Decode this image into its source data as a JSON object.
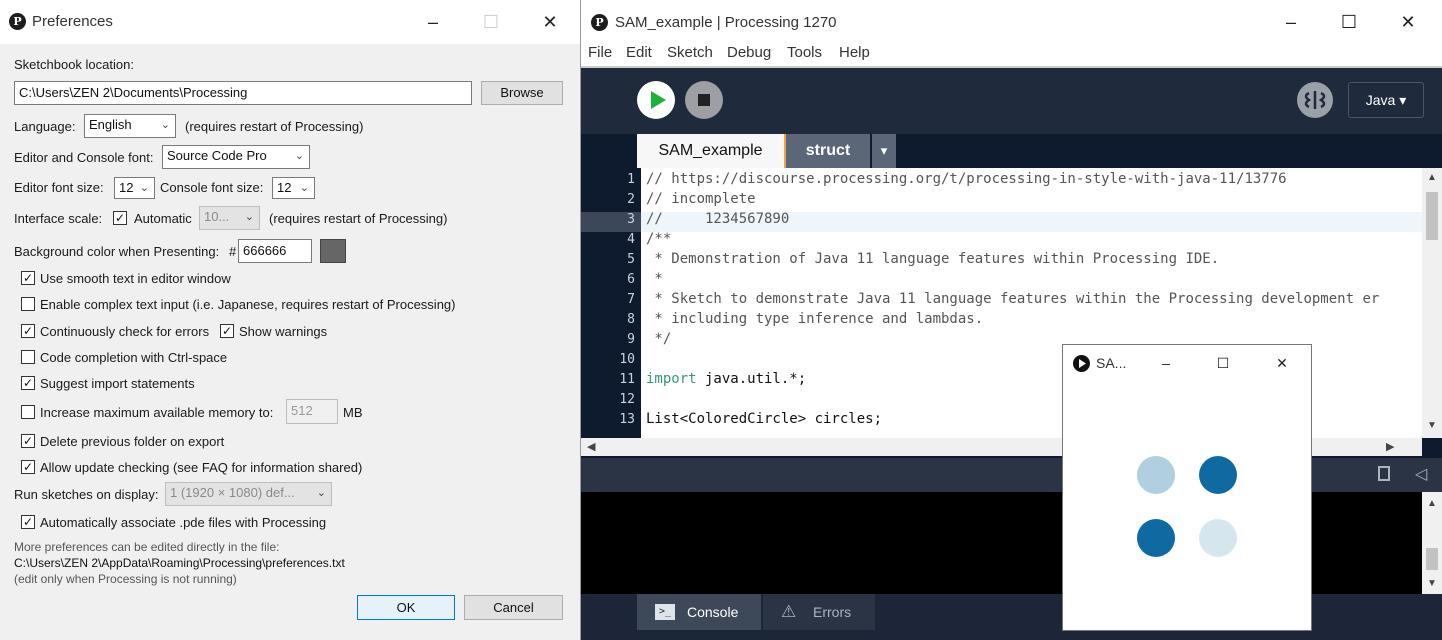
{
  "prefs": {
    "title": "Preferences",
    "sketchbook_label": "Sketchbook location:",
    "sketchbook_path": "C:\\Users\\ZEN 2\\Documents\\Processing",
    "browse": "Browse",
    "language_label": "Language:",
    "language_value": "English",
    "language_note": "(requires restart of Processing)",
    "font_label": "Editor and Console font:",
    "font_value": "Source Code Pro",
    "editor_size_label": "Editor font size:",
    "editor_size_value": "12",
    "console_size_label": "Console font size:",
    "console_size_value": "12",
    "scale_label": "Interface scale:",
    "scale_auto_label": "Automatic",
    "scale_value": "10...",
    "scale_note": "(requires restart of Processing)",
    "bg_label": "Background color when Presenting:",
    "bg_hash": "#",
    "bg_value": "666666",
    "bg_color": "#666666",
    "options": {
      "smooth": "Use smooth text in editor window",
      "complex": "Enable complex text input (i.e. Japanese, requires restart of Processing)",
      "check_errors": "Continuously check for errors",
      "warnings": "Show warnings",
      "completion": "Code completion with Ctrl-space",
      "imports": "Suggest import statements",
      "memory": "Increase maximum available memory to:",
      "memory_value": "512",
      "memory_unit": "MB",
      "delete_prev": "Delete previous folder on export",
      "update_check": "Allow update checking (see FAQ for information shared)",
      "associate": "Automatically associate .pde files with Processing"
    },
    "display_label": "Run sketches on display:",
    "display_value": "1 (1920 × 1080) def...",
    "more_note": "More preferences can be edited directly in the file:",
    "prefs_path": "C:\\Users\\ZEN 2\\AppData\\Roaming\\Processing\\preferences.txt",
    "edit_note": "(edit only when Processing is not running)",
    "ok": "OK",
    "cancel": "Cancel"
  },
  "ide": {
    "title": "SAM_example | Processing 1270",
    "menu": [
      "File",
      "Edit",
      "Sketch",
      "Debug",
      "Tools",
      "Help"
    ],
    "mode": "Java ▾",
    "tabs": [
      "SAM_example",
      "struct"
    ],
    "tab_menu": "▾",
    "code": [
      "// https://discourse.processing.org/t/processing-in-style-with-java-11/13776",
      "// incomplete",
      "//     1234567890",
      "/**",
      " * Demonstration of Java 11 language features within Processing IDE.",
      " *",
      " * Sketch to demonstrate Java 11 language features within the Processing development er",
      " * including type inference and lambdas.",
      " */",
      "",
      "import java.util.*;",
      "",
      "List<ColoredCircle> circles;"
    ],
    "import_kw": "import",
    "import_rest": " java.util.*;",
    "footer_console": "Console",
    "footer_errors": "Errors"
  },
  "sketch": {
    "title": "SA...",
    "colors": {
      "light": "#b0cfe1",
      "dark": "#0f6aa1",
      "pale": "#d6e6ef"
    }
  }
}
